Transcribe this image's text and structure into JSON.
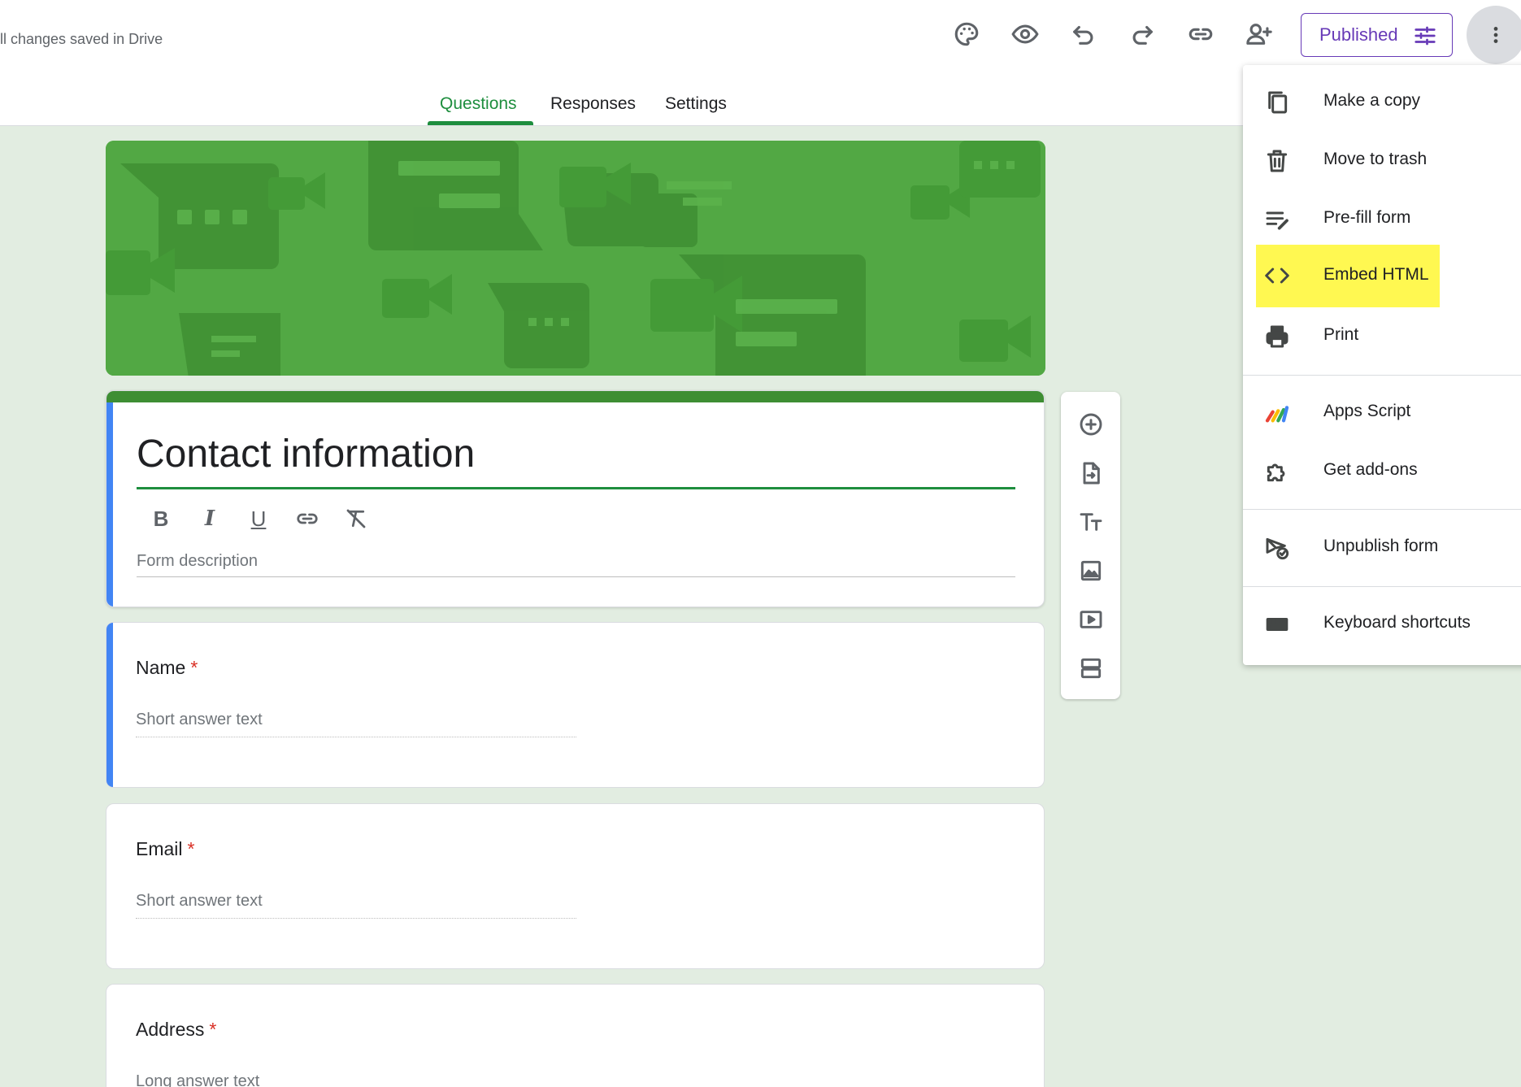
{
  "header": {
    "save_status": "ll changes saved in Drive",
    "published_label": "Published",
    "icons": [
      "palette-icon",
      "preview-eye-icon",
      "undo-icon",
      "redo-icon",
      "copy-link-icon",
      "add-collaborator-icon",
      "tune-icon",
      "more-vert-icon"
    ]
  },
  "tabs": [
    {
      "label": "Questions",
      "active": true
    },
    {
      "label": "Responses",
      "active": false
    },
    {
      "label": "Settings",
      "active": false
    }
  ],
  "form": {
    "title": "Contact information",
    "description_placeholder": "Form description",
    "format_buttons": [
      "B",
      "I",
      "U"
    ]
  },
  "questions": [
    {
      "title": "Name",
      "required_mark": "*",
      "answer_placeholder": "Short answer text"
    },
    {
      "title": "Email",
      "required_mark": "*",
      "answer_placeholder": "Short answer text"
    },
    {
      "title": "Address",
      "required_mark": "*",
      "answer_placeholder": "Long answer text"
    }
  ],
  "menu": {
    "items": [
      {
        "label": "Make a copy",
        "icon": "copy-icon"
      },
      {
        "label": "Move to trash",
        "icon": "trash-icon"
      },
      {
        "label": "Pre-fill form",
        "icon": "prefill-icon"
      },
      {
        "label": "Embed HTML",
        "icon": "code-icon",
        "highlighted": true
      },
      {
        "label": "Print",
        "icon": "print-icon"
      },
      {
        "label": "Apps Script",
        "icon": "apps-script-icon"
      },
      {
        "label": "Get add-ons",
        "icon": "add-ons-icon"
      },
      {
        "label": "Unpublish form",
        "icon": "unpublish-icon"
      },
      {
        "label": "Keyboard shortcuts",
        "icon": "keyboard-icon"
      }
    ]
  },
  "colors": {
    "accent_green": "#1e8e3e",
    "published_purple": "#673ab7",
    "highlight_yellow": "#fff851",
    "background": "#e2ede1",
    "question_bar_blue": "#4285f4",
    "required_red": "#d93025"
  }
}
